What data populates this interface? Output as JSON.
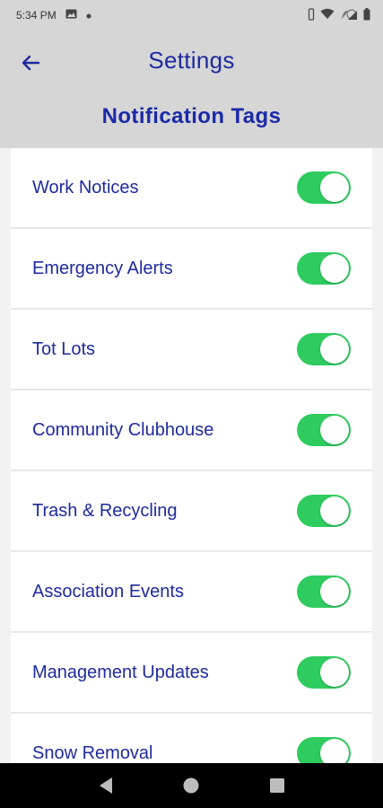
{
  "status_bar": {
    "time": "5:34 PM",
    "icons": [
      "image-icon",
      "dot-icon",
      "vibrate-icon",
      "wifi-icon",
      "signal-icon",
      "battery-icon"
    ]
  },
  "header": {
    "title": "Settings",
    "back_icon": "arrow-left-icon",
    "section_title": "Notification Tags"
  },
  "tags": [
    {
      "label": "Work Notices",
      "enabled": true
    },
    {
      "label": "Emergency Alerts",
      "enabled": true
    },
    {
      "label": "Tot Lots",
      "enabled": true
    },
    {
      "label": "Community Clubhouse",
      "enabled": true
    },
    {
      "label": "Trash & Recycling",
      "enabled": true
    },
    {
      "label": "Association Events",
      "enabled": true
    },
    {
      "label": "Management Updates",
      "enabled": true
    },
    {
      "label": "Snow Removal",
      "enabled": true
    }
  ],
  "colors": {
    "accent_text": "#1e2a9e",
    "toggle_on": "#2ecc5f",
    "header_bg": "#d6d6d6"
  },
  "nav_bar": {
    "buttons": [
      "back-triangle-icon",
      "home-circle-icon",
      "recents-square-icon"
    ]
  }
}
